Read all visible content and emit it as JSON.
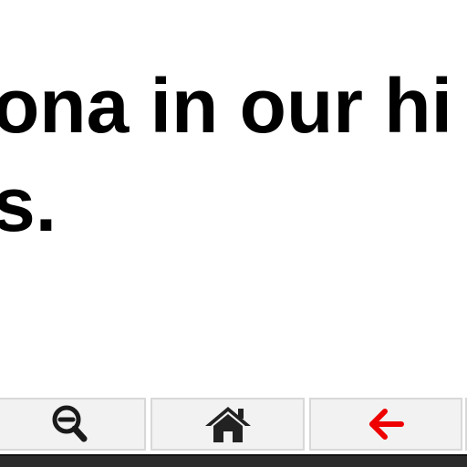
{
  "content": {
    "line1": "ona in our hi",
    "line2": "s."
  },
  "toolbar": {
    "buttons": [
      {
        "name": "zoom-out",
        "icon": "zoom-out-icon",
        "color": "#1a1a1a"
      },
      {
        "name": "home",
        "icon": "home-icon",
        "color": "#222222"
      },
      {
        "name": "back",
        "icon": "arrow-left-icon",
        "color": "#ee0000"
      }
    ]
  }
}
